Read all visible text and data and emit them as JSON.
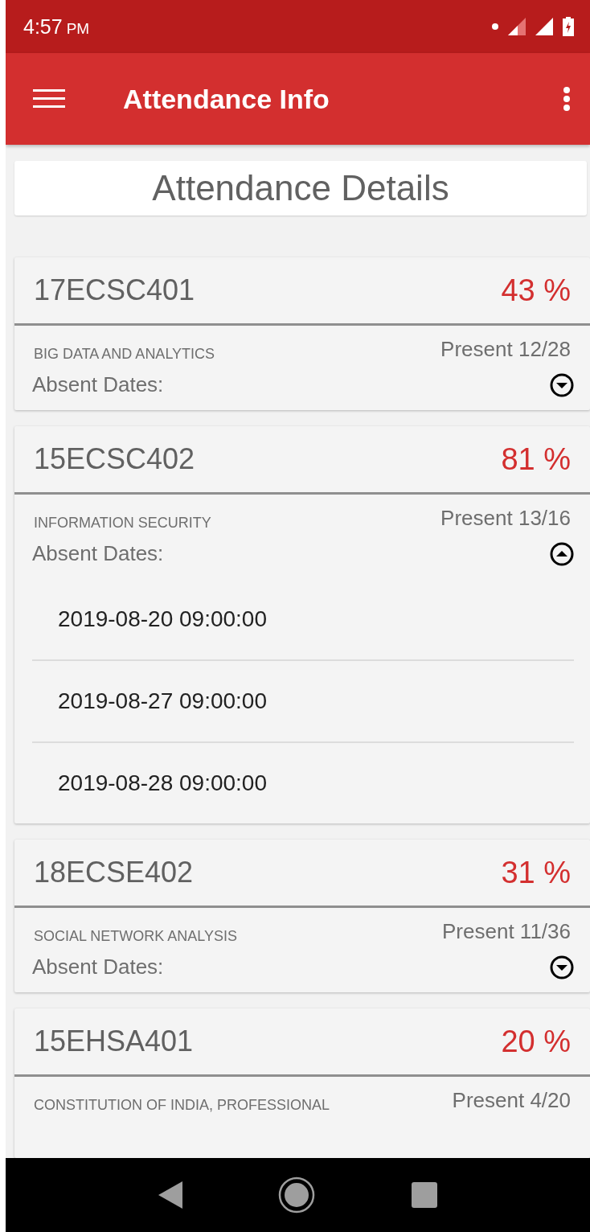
{
  "status_bar": {
    "time": "4:57",
    "ampm": "PM"
  },
  "app_bar": {
    "title": "Attendance Info"
  },
  "header": {
    "title": "Attendance Details"
  },
  "courses": [
    {
      "code": "17ECSC401",
      "percent": "43 %",
      "subject": "BIG DATA AND ANALYTICS",
      "present": "Present 12/28",
      "absent_label": "Absent Dates:",
      "expanded": false
    },
    {
      "code": "15ECSC402",
      "percent": "81 %",
      "subject": "INFORMATION SECURITY",
      "present": "Present 13/16",
      "absent_label": "Absent Dates:",
      "expanded": true,
      "dates": [
        "2019-08-20 09:00:00",
        "2019-08-27 09:00:00",
        "2019-08-28 09:00:00"
      ]
    },
    {
      "code": "18ECSE402",
      "percent": "31 %",
      "subject": "SOCIAL NETWORK ANALYSIS",
      "present": "Present 11/36",
      "absent_label": "Absent Dates:",
      "expanded": false
    },
    {
      "code": "15EHSA401",
      "percent": "20 %",
      "subject": "CONSTITUTION OF INDIA, PROFESSIONAL",
      "present": "Present 4/20"
    }
  ]
}
